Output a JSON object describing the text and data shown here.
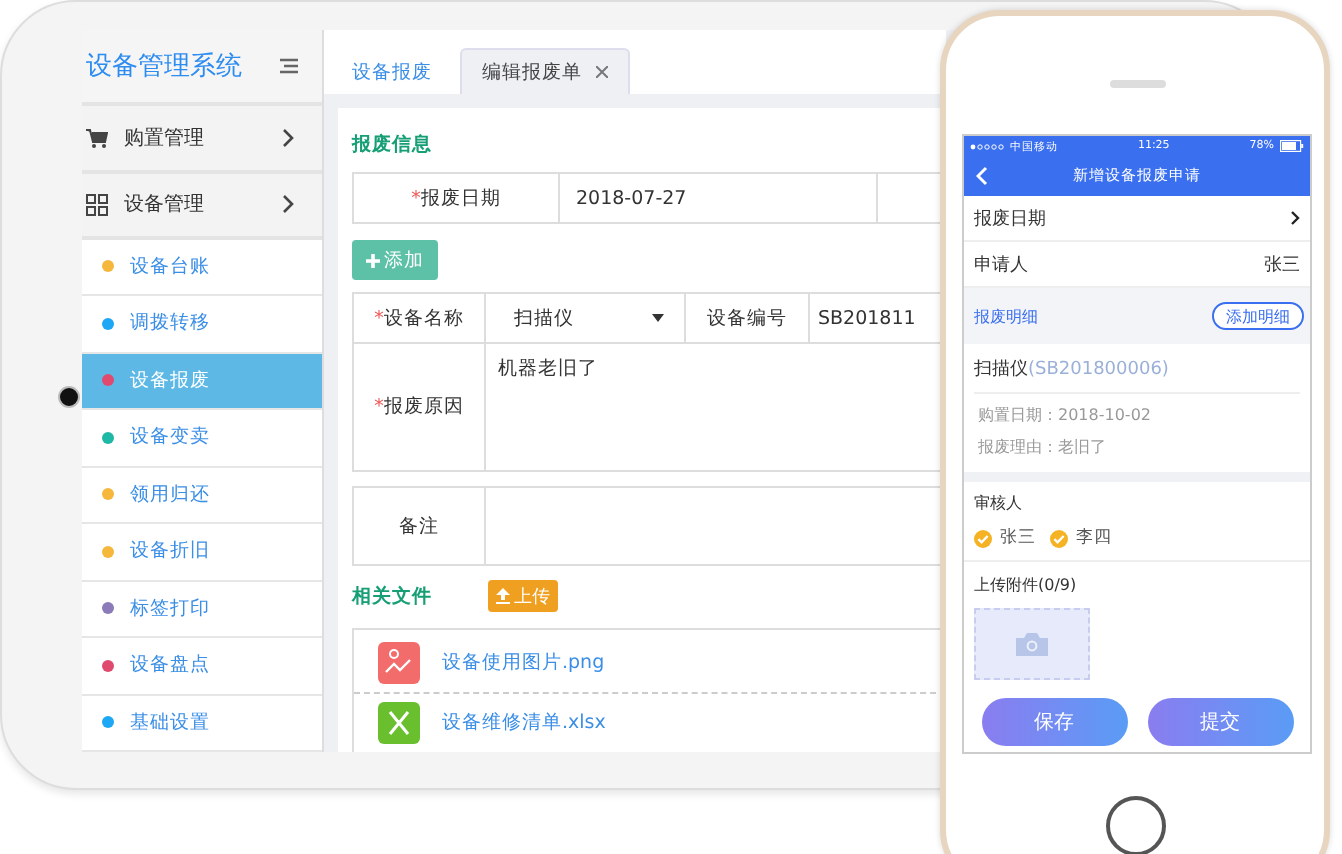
{
  "tablet": {
    "sidebar": {
      "title": "设备管理系统",
      "groups": [
        {
          "label": "购置管理",
          "kind": "cart"
        },
        {
          "label": "设备管理",
          "kind": "grid"
        }
      ],
      "items": [
        {
          "label": "设备台账",
          "color": "#f5b83d",
          "selected": false
        },
        {
          "label": "调拨转移",
          "color": "#1ea7f5",
          "selected": false
        },
        {
          "label": "设备报废",
          "color": "#e04a6f",
          "selected": true
        },
        {
          "label": "设备变卖",
          "color": "#1fb8a6",
          "selected": false
        },
        {
          "label": "领用归还",
          "color": "#f5b83d",
          "selected": false
        },
        {
          "label": "设备折旧",
          "color": "#f5b83d",
          "selected": false
        },
        {
          "label": "标签打印",
          "color": "#8c7bb8",
          "selected": false
        },
        {
          "label": "设备盘点",
          "color": "#e04a6f",
          "selected": false
        },
        {
          "label": "基础设置",
          "color": "#1ea7f5",
          "selected": false
        }
      ]
    },
    "tabs": [
      {
        "label": "设备报废",
        "selected": false,
        "closable": false
      },
      {
        "label": "编辑报废单",
        "selected": true,
        "closable": true
      }
    ],
    "form": {
      "section_title": "报废信息",
      "date_label": {
        "mark": "*",
        "text": "报废日期"
      },
      "date_value": "2018-07-27",
      "add_button": "添加",
      "name_label": {
        "mark": "*",
        "text": "设备名称"
      },
      "name_value": "扫描仪",
      "code_label": "设备编号",
      "code_value": "SB201811",
      "reason_label": {
        "mark": "*",
        "text": "报废原因"
      },
      "reason_value": "机器老旧了",
      "note_label": "备注"
    },
    "files": {
      "title": "相关文件",
      "upload_button": "上传",
      "items": [
        {
          "name": "设备使用图片.png",
          "kind": "image"
        },
        {
          "name": "设备维修清单.xlsx",
          "kind": "excel"
        }
      ]
    }
  },
  "phone": {
    "status_bar": {
      "carrier": "中国移动",
      "time": "11:25",
      "battery": "78%"
    },
    "nav_title": "新增设备报废申请",
    "date_label": "报废日期",
    "applicant_label": "申请人",
    "applicant_value": "张三",
    "detail_title": "报废明细",
    "add_detail_button": "添加明细",
    "item": {
      "name": "扫描仪",
      "code": "(SB201800006)",
      "purchase": "购置日期：2018-10-02",
      "reason": "报废理由：老旧了"
    },
    "reviewers_title": "审核人",
    "reviewers": [
      {
        "name": "张三",
        "checked": true
      },
      {
        "name": "李四",
        "checked": true
      }
    ],
    "upload_title": "上传附件(0/9)",
    "buttons": [
      "保存",
      "提交"
    ]
  }
}
